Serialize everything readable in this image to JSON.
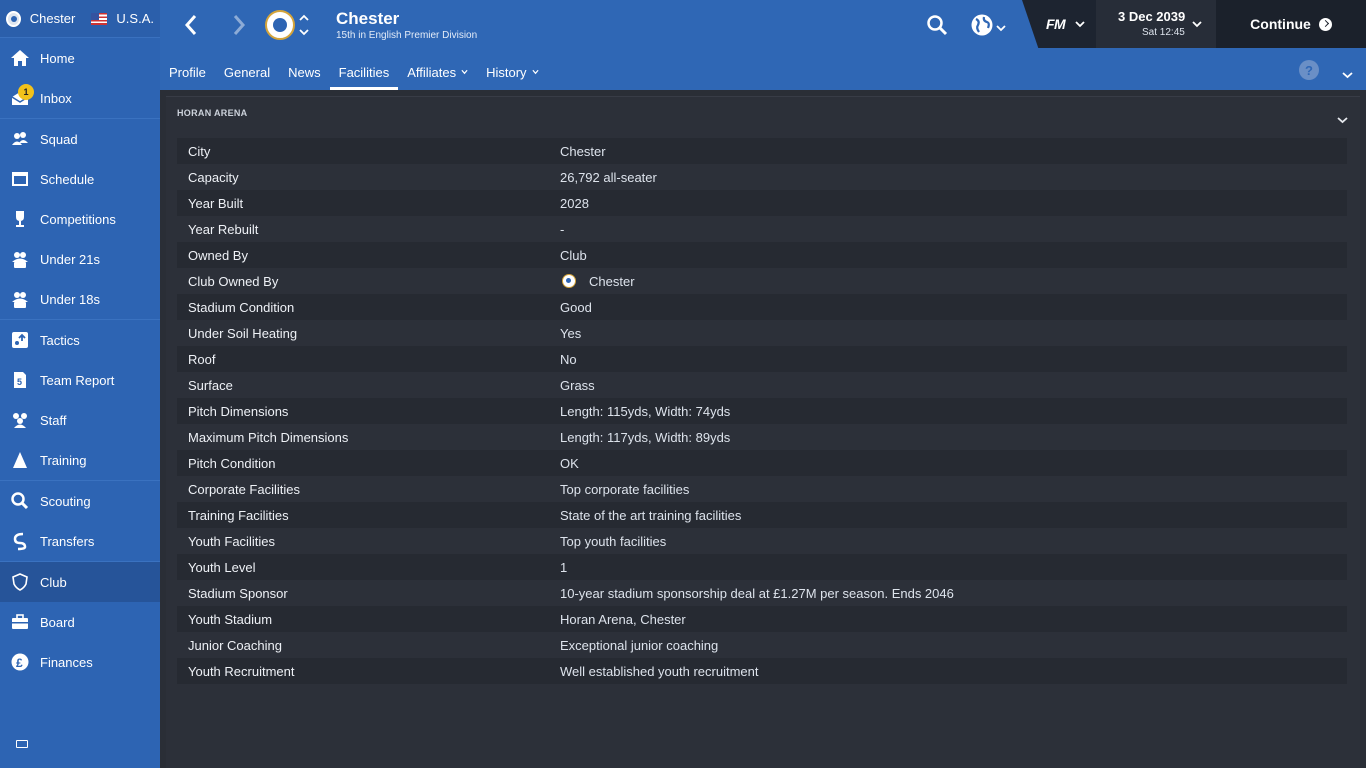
{
  "sidebar": {
    "club": "Chester",
    "nation": "U.S.A.",
    "inbox_badge": "1",
    "items": [
      {
        "label": "Home",
        "icon": "home-icon"
      },
      {
        "label": "Inbox",
        "icon": "inbox-icon"
      },
      {
        "label": "Squad",
        "icon": "squad-icon"
      },
      {
        "label": "Schedule",
        "icon": "schedule-icon"
      },
      {
        "label": "Competitions",
        "icon": "trophy-icon"
      },
      {
        "label": "Under 21s",
        "icon": "under21-icon"
      },
      {
        "label": "Under 18s",
        "icon": "under18-icon"
      },
      {
        "label": "Tactics",
        "icon": "tactics-icon"
      },
      {
        "label": "Team Report",
        "icon": "team-report-icon"
      },
      {
        "label": "Staff",
        "icon": "staff-icon"
      },
      {
        "label": "Training",
        "icon": "training-icon"
      },
      {
        "label": "Scouting",
        "icon": "search-icon"
      },
      {
        "label": "Transfers",
        "icon": "transfers-icon"
      },
      {
        "label": "Club",
        "icon": "shield-icon"
      },
      {
        "label": "Board",
        "icon": "board-icon"
      },
      {
        "label": "Finances",
        "icon": "pound-icon"
      }
    ]
  },
  "header": {
    "title": "Chester",
    "subtitle": "15th in English Premier Division",
    "date": "3 Dec 2039",
    "time": "Sat 12:45",
    "fm_label": "FM",
    "continue_label": "Continue",
    "help_label": "?"
  },
  "tabs": [
    {
      "label": "Profile"
    },
    {
      "label": "General"
    },
    {
      "label": "News"
    },
    {
      "label": "Facilities"
    },
    {
      "label": "Affiliates"
    },
    {
      "label": "History"
    }
  ],
  "panel": {
    "title": "HORAN ARENA",
    "rows": [
      {
        "key": "City",
        "value": "Chester"
      },
      {
        "key": "Capacity",
        "value": "26,792 all-seater"
      },
      {
        "key": "Year Built",
        "value": "2028"
      },
      {
        "key": "Year Rebuilt",
        "value": "-"
      },
      {
        "key": "Owned By",
        "value": "Club"
      },
      {
        "key": "Club Owned By",
        "value": "Chester"
      },
      {
        "key": "Stadium Condition",
        "value": "Good"
      },
      {
        "key": "Under Soil Heating",
        "value": "Yes"
      },
      {
        "key": "Roof",
        "value": "No"
      },
      {
        "key": "Surface",
        "value": "Grass"
      },
      {
        "key": "Pitch Dimensions",
        "value": "Length: 115yds, Width: 74yds"
      },
      {
        "key": "Maximum Pitch Dimensions",
        "value": "Length: 117yds, Width: 89yds"
      },
      {
        "key": "Pitch Condition",
        "value": "OK"
      },
      {
        "key": "Corporate Facilities",
        "value": "Top corporate facilities"
      },
      {
        "key": "Training Facilities",
        "value": "State of the art training facilities"
      },
      {
        "key": "Youth Facilities",
        "value": "Top youth facilities"
      },
      {
        "key": "Youth Level",
        "value": "1"
      },
      {
        "key": "Stadium Sponsor",
        "value": "10-year stadium sponsorship deal at £1.27M per season. Ends 2046"
      },
      {
        "key": "Youth Stadium",
        "value": "Horan Arena, Chester"
      },
      {
        "key": "Junior Coaching",
        "value": "Exceptional junior coaching"
      },
      {
        "key": "Youth Recruitment",
        "value": "Well established youth recruitment"
      }
    ]
  },
  "colors": {
    "sidebar": "#2d64b3",
    "header": "#2f67b5",
    "content_bg": "#2c3039",
    "badge": "#f2c21b"
  }
}
